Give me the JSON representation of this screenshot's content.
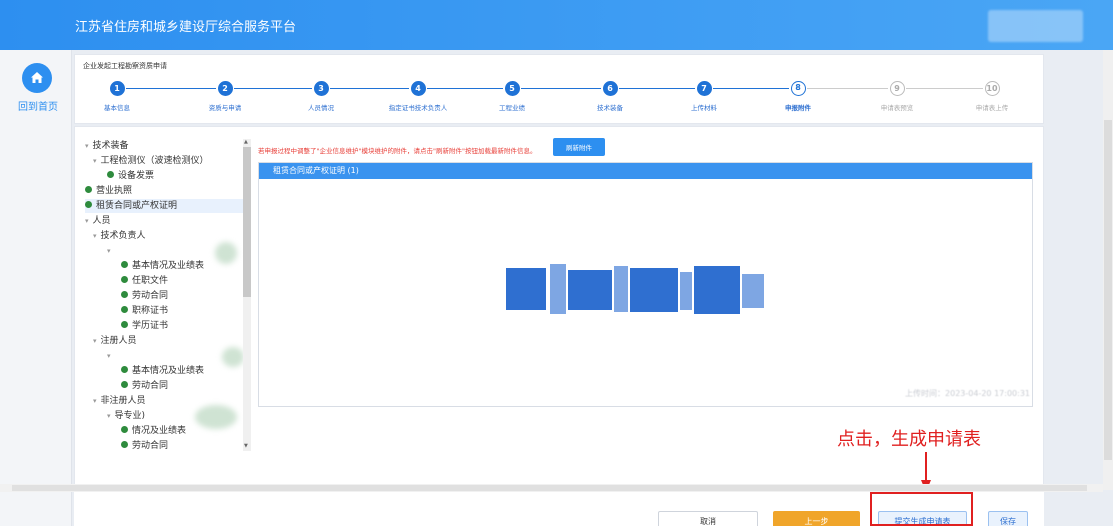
{
  "header": {
    "title": "江苏省住房和城乡建设厅综合服务平台"
  },
  "nav": {
    "home_label": "回到首页"
  },
  "steps": {
    "heading": "企业发起工程勘察资质申请",
    "items": [
      {
        "num": "1",
        "label": "基本信息",
        "state": "done"
      },
      {
        "num": "2",
        "label": "资质与申请",
        "state": "done"
      },
      {
        "num": "3",
        "label": "人员情况",
        "state": "done"
      },
      {
        "num": "4",
        "label": "指定证书技术负责人",
        "state": "done"
      },
      {
        "num": "5",
        "label": "工程业绩",
        "state": "done"
      },
      {
        "num": "6",
        "label": "技术装备",
        "state": "done"
      },
      {
        "num": "7",
        "label": "上传材料",
        "state": "done"
      },
      {
        "num": "8",
        "label": "申报附件",
        "state": "current"
      },
      {
        "num": "9",
        "label": "申请表预览",
        "state": "todo"
      },
      {
        "num": "10",
        "label": "申请表上传",
        "state": "todo"
      }
    ]
  },
  "tree": {
    "items": [
      {
        "text": "技术装备",
        "level": 0,
        "type": "caret"
      },
      {
        "text": "工程检测仪（波速检测仪）",
        "level": 1,
        "type": "caret"
      },
      {
        "text": "设备发票",
        "level": 2,
        "type": "check"
      },
      {
        "text": "营业执照",
        "level": 0,
        "type": "check"
      },
      {
        "text": "租赁合同或产权证明",
        "level": 0,
        "type": "check",
        "selected": true
      },
      {
        "text": "人员",
        "level": 0,
        "type": "caret"
      },
      {
        "text": "技术负责人",
        "level": 1,
        "type": "caret"
      },
      {
        "text": "",
        "level": 2,
        "type": "caret"
      },
      {
        "text": "基本情况及业绩表",
        "level": 3,
        "type": "check"
      },
      {
        "text": "任职文件",
        "level": 3,
        "type": "check"
      },
      {
        "text": "劳动合同",
        "level": 3,
        "type": "check"
      },
      {
        "text": "职称证书",
        "level": 3,
        "type": "check"
      },
      {
        "text": "学历证书",
        "level": 3,
        "type": "check"
      },
      {
        "text": "注册人员",
        "level": 1,
        "type": "caret"
      },
      {
        "text": "",
        "level": 2,
        "type": "caret"
      },
      {
        "text": "基本情况及业绩表",
        "level": 3,
        "type": "check"
      },
      {
        "text": "劳动合同",
        "level": 3,
        "type": "check"
      },
      {
        "text": "非注册人员",
        "level": 1,
        "type": "caret"
      },
      {
        "text": "导专业)",
        "level": 2,
        "type": "caret"
      },
      {
        "text": "情况及业绩表",
        "level": 3,
        "type": "check"
      },
      {
        "text": "劳动合同",
        "level": 3,
        "type": "check"
      }
    ]
  },
  "notice": "若申报过程中调整了\"企业信息维护\"模块维护的附件，请点击\"刷新附件\"按钮加载最新附件信息。",
  "refresh_label": "刷新附件",
  "viewer": {
    "header": "租赁合同或产权证明 (1)",
    "upload_time": "上传时间：2023-04-20 17:00:31"
  },
  "annotation": {
    "text": "点击，生成申请表"
  },
  "footer": {
    "cancel": "取消",
    "prev": "上一步",
    "submit": "提交生成申请表",
    "save": "保存"
  },
  "colors": {
    "primary": "#2d8ff0",
    "accent_orange": "#f0a52a",
    "annotation_red": "#e02020",
    "check_green": "#2e8b3d"
  }
}
